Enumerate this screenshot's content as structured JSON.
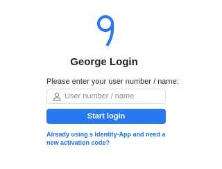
{
  "brand": {
    "logo_icon": "george-g-logo-icon",
    "accent_color": "#2878f0"
  },
  "login": {
    "title": "George Login",
    "prompt": "Please enter your user number / name:",
    "input": {
      "placeholder": "User number / name",
      "value": "",
      "icon": "user-icon"
    },
    "submit_label": "Start login",
    "activation_link_text": "Already using s Identity-App and need a new activation code?"
  }
}
